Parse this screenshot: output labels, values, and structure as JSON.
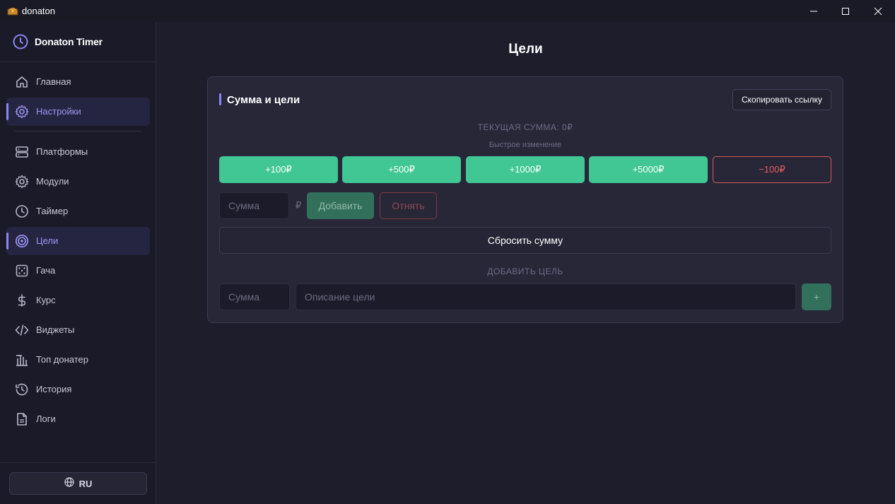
{
  "window": {
    "title": "donaton",
    "icons": {
      "app": "treasure-chest-icon",
      "minimize": "minimize-icon",
      "maximize": "maximize-icon",
      "close": "close-icon"
    }
  },
  "sidebar": {
    "brand": {
      "title": "Donaton Timer",
      "icon": "clock-icon"
    },
    "items": [
      {
        "label": "Главная",
        "icon": "home-icon"
      },
      {
        "label": "Настройки",
        "icon": "gear-icon"
      },
      {
        "label": "Платформы",
        "icon": "server-icon"
      },
      {
        "label": "Модули",
        "icon": "gear-icon"
      },
      {
        "label": "Таймер",
        "icon": "clock-icon"
      },
      {
        "label": "Цели",
        "icon": "target-icon"
      },
      {
        "label": "Гача",
        "icon": "dice-icon"
      },
      {
        "label": "Курс",
        "icon": "dollar-icon"
      },
      {
        "label": "Виджеты",
        "icon": "code-icon"
      },
      {
        "label": "Топ донатер",
        "icon": "podium-icon"
      },
      {
        "label": "История",
        "icon": "history-icon"
      },
      {
        "label": "Логи",
        "icon": "file-icon"
      }
    ],
    "active_items": [
      "Настройки",
      "Цели"
    ],
    "language": {
      "label": "RU",
      "icon": "globe-icon"
    }
  },
  "main": {
    "page_title": "Цели",
    "card": {
      "title": "Сумма и цели",
      "copy_link_label": "Скопировать ссылку",
      "current_sum_label": "ТЕКУЩАЯ СУММА: 0₽",
      "quick_change_label": "Быстрое изменение",
      "quick_buttons": [
        "+100₽",
        "+500₽",
        "+1000₽",
        "+5000₽",
        "−100₽"
      ],
      "sum_placeholder": "Сумма",
      "currency": "₽",
      "add_label": "Добавить",
      "subtract_label": "Отнять",
      "reset_label": "Сбросить сумму",
      "add_goal_label": "ДОБАВИТЬ ЦЕЛЬ",
      "goal_sum_placeholder": "Сумма",
      "goal_desc_placeholder": "Описание цели",
      "goal_add_label": "+"
    }
  },
  "colors": {
    "accent": "#8b86f4",
    "green": "#40c793",
    "red": "#e25c5c",
    "background": "#1e1d2c",
    "sidebar": "#1b1a28",
    "card": "#282738"
  }
}
